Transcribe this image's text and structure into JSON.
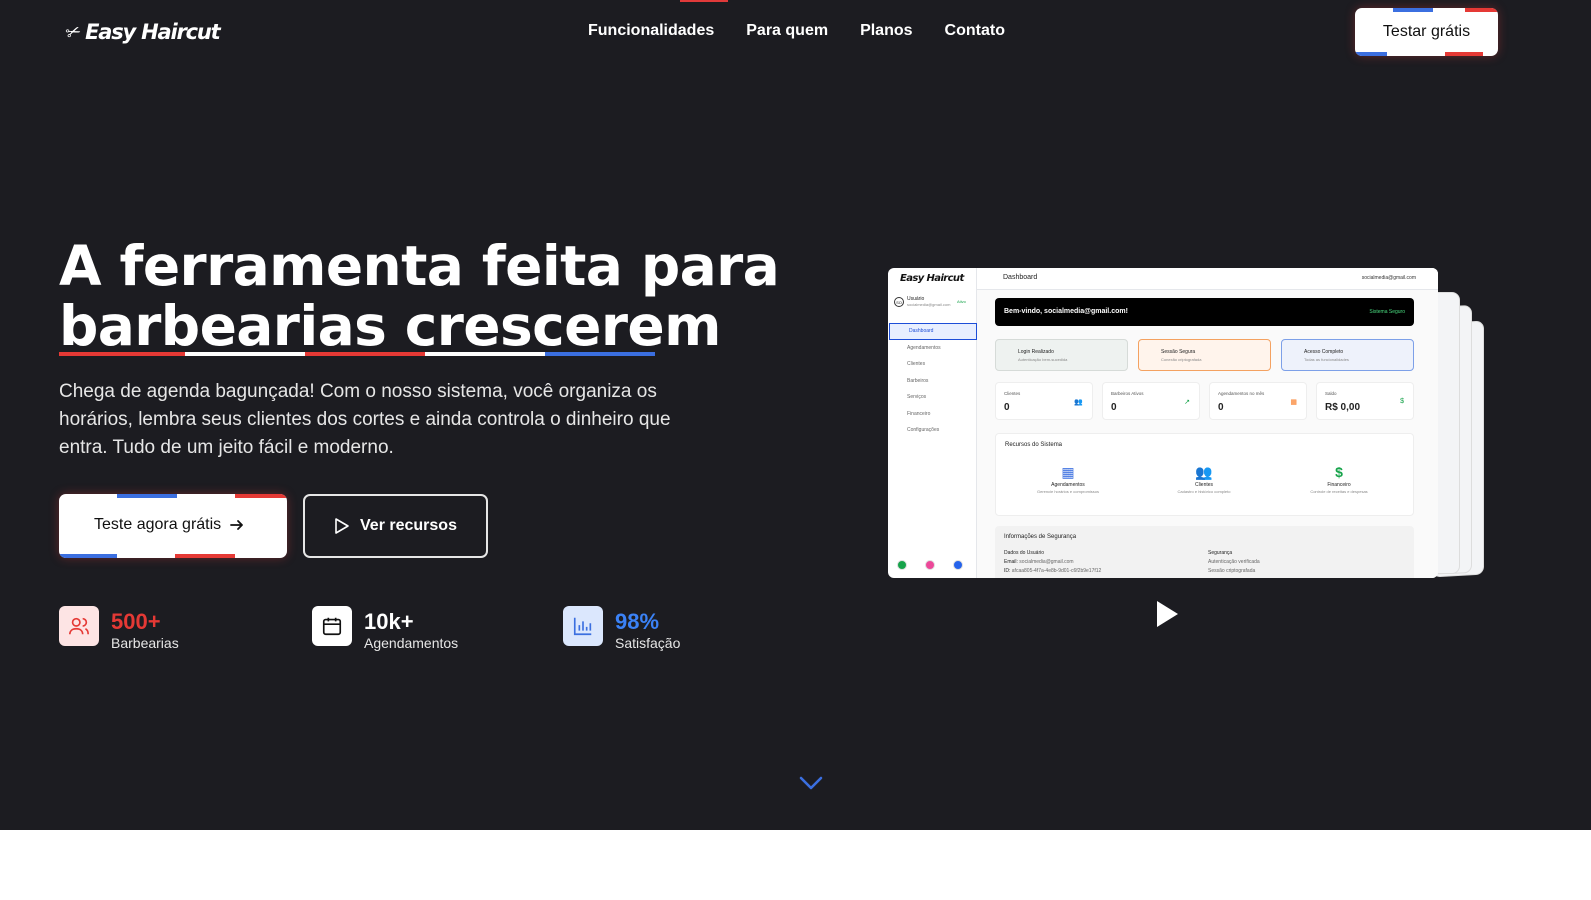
{
  "brand": {
    "name": "Easy Haircut"
  },
  "nav": {
    "items": [
      "Funcionalidades",
      "Para quem",
      "Planos",
      "Contato"
    ],
    "cta": "Testar grátis"
  },
  "hero": {
    "title_line1": "A ferramenta feita para",
    "title_line2": "barbearias crescerem",
    "subtitle": "Chega de agenda bagunçada! Com o nosso sistema, você organiza os horários, lembra seus clientes dos cortes e ainda controla o dinheiro que entra. Tudo de um jeito fácil e moderno.",
    "primary_cta": "Teste agora grátis",
    "secondary_cta": "Ver recursos"
  },
  "stats": [
    {
      "value": "500+",
      "label": "Barbearias",
      "icon": "users-icon",
      "color": "#e53935"
    },
    {
      "value": "10k+",
      "label": "Agendamentos",
      "icon": "calendar-icon",
      "color": "#ffffff"
    },
    {
      "value": "98%",
      "label": "Satisfação",
      "icon": "bar-chart-icon",
      "color": "#3b82f6"
    }
  ],
  "mockup": {
    "logo": "Easy Haircut",
    "user_name": "Usuário",
    "user_email": "socialmedia@gmail.com",
    "user_status": "Ativo",
    "menu": [
      "Dashboard",
      "Agendamentos",
      "Clientes",
      "Barbeiros",
      "Serviços",
      "Financeiro",
      "Configurações"
    ],
    "page_title": "Dashboard",
    "header_email": "socialmedia@gmail.com",
    "welcome": "Bem-vindo, socialmedia@gmail.com!",
    "secure_label": "Sistema Seguro",
    "badges": [
      {
        "title": "Login Realizado",
        "sub": "Autenticação bem-sucedida"
      },
      {
        "title": "Sessão Segura",
        "sub": "Conexão criptografada"
      },
      {
        "title": "Acesso Completo",
        "sub": "Todas as funcionalidades"
      }
    ],
    "kpis": [
      {
        "label": "Clientes",
        "value": "0"
      },
      {
        "label": "Barbeiros Ativos",
        "value": "0"
      },
      {
        "label": "Agendamentos no mês",
        "value": "0"
      },
      {
        "label": "Saldo",
        "value": "R$ 0,00"
      }
    ],
    "resources_title": "Recursos do Sistema",
    "resources": [
      {
        "name": "Agendamentos",
        "desc": "Gerencie horários e compromissos"
      },
      {
        "name": "Clientes",
        "desc": "Cadastro e histórico completo"
      },
      {
        "name": "Financeiro",
        "desc": "Controle de receitas e despesas"
      }
    ],
    "security_title": "Informações de Segurança",
    "user_data_title": "Dados do Usuário",
    "email_label": "Email:",
    "email_value": "socialmedia@gmail.com",
    "id_label": "ID:",
    "id_value": "afcaa805-4f7a-4e8b-9d01-c6f2b9e17f12",
    "security_sub": "Segurança",
    "security_items": [
      "Autenticação verificada",
      "Sessão criptografada"
    ]
  },
  "colors": {
    "accent_red": "#e53935",
    "accent_blue": "#3b6fe0",
    "background": "#1c1c21"
  }
}
